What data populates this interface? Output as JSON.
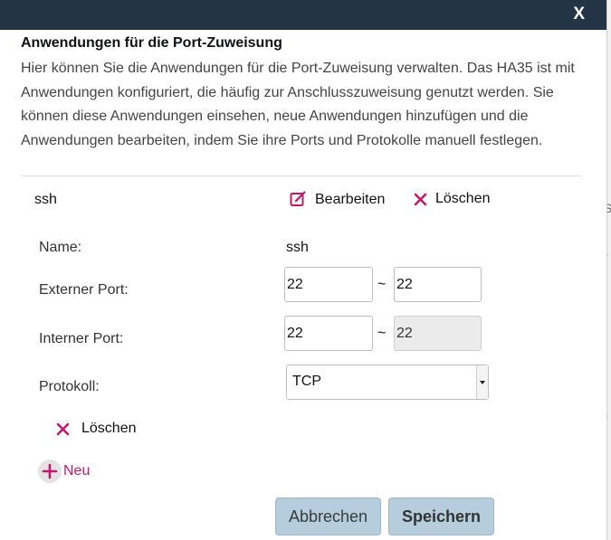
{
  "dialog": {
    "close_label": "X",
    "title": "Anwendungen für die Port-Zuweisung",
    "description": "Hier können Sie die Anwendungen für die Port-Zuweisung verwalten. Das HA35 ist mit Anwendungen konfiguriert, die häufig zur Anschlusszuweisung genutzt werden. Sie können diese Anwendungen einsehen, neue Anwendungen hinzufügen und die Anwendungen bearbeiten, indem Sie ihre Ports und Protokolle manuell festlegen."
  },
  "application": {
    "name": "ssh",
    "edit_label": "Bearbeiten",
    "delete_label": "Löschen"
  },
  "form": {
    "name_label": "Name:",
    "name_value": "ssh",
    "external_port_label": "Externer Port:",
    "external_port_from": "22",
    "external_port_to": "22",
    "range_separator": "~",
    "internal_port_label": "Interner Port:",
    "internal_port_from": "22",
    "internal_port_to": "22",
    "protocol_label": "Protokoll:",
    "protocol_value": "TCP",
    "row_delete_label": "Löschen",
    "new_label": "Neu"
  },
  "buttons": {
    "cancel": "Abbrechen",
    "save": "Speichern"
  },
  "colors": {
    "titlebar": "#233447",
    "accent": "#c2186b",
    "button": "#b5cddd"
  },
  "icons": [
    "close-icon",
    "edit-icon",
    "delete-icon",
    "plus-icon",
    "chevron-down-icon"
  ]
}
